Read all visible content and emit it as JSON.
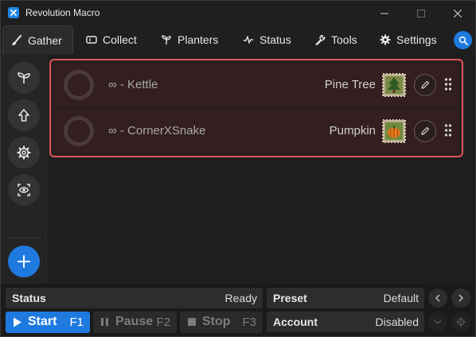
{
  "window": {
    "title": "Revolution Macro",
    "controls": {
      "minimize": "—",
      "maximize": "☐",
      "close": "✕"
    }
  },
  "tabs": [
    {
      "label": "Gather",
      "icon": "brush-icon",
      "active": true
    },
    {
      "label": "Collect",
      "icon": "ticket-icon",
      "active": false
    },
    {
      "label": "Planters",
      "icon": "sprout-icon",
      "active": false
    },
    {
      "label": "Status",
      "icon": "pulse-icon",
      "active": false
    },
    {
      "label": "Tools",
      "icon": "wrench-icon",
      "active": false
    },
    {
      "label": "Settings",
      "icon": "gear-icon",
      "active": false
    }
  ],
  "sidebar": {
    "items": [
      {
        "icon": "sprout-icon"
      },
      {
        "icon": "arrow-up-icon"
      },
      {
        "icon": "gear-icon"
      },
      {
        "icon": "eye-scan-icon"
      }
    ],
    "add_icon": "plus-icon"
  },
  "gather_list": [
    {
      "label": "∞ - Kettle",
      "field": "Pine Tree",
      "field_icon": "pine-tree-stamp-icon"
    },
    {
      "label": "∞ - CornerXSnake",
      "field": "Pumpkin",
      "field_icon": "pumpkin-stamp-icon"
    }
  ],
  "bottom": {
    "status_label": "Status",
    "status_value": "Ready",
    "preset_label": "Preset",
    "preset_value": "Default",
    "account_label": "Account",
    "account_value": "Disabled",
    "start": {
      "label": "Start",
      "key": "F1"
    },
    "pause": {
      "label": "Pause",
      "key": "F2"
    },
    "stop": {
      "label": "Stop",
      "key": "F3"
    }
  },
  "colors": {
    "accent": "#1f7ae0",
    "selection_border": "#e0545c",
    "row_bg": "#331f1f"
  }
}
